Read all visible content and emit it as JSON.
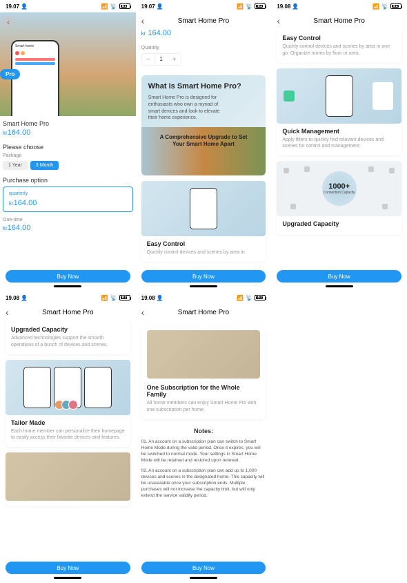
{
  "status": {
    "time1": "19.07",
    "time2": "19.08",
    "battery": "81",
    "user_icon": "👤"
  },
  "header": {
    "title": "Smart Home Pro"
  },
  "product": {
    "name": "Smart Home Pro",
    "currency": "kr",
    "price": "164.00",
    "pro_badge": "Pro"
  },
  "p1": {
    "choose": "Please choose",
    "package": "Package",
    "pills": [
      "1 Year",
      "3 Month"
    ],
    "pill_active": 1,
    "purchase_option": "Purchase option",
    "opt_quarterly": "quarterly",
    "opt_onetime": "One-time",
    "buy": "Buy Now"
  },
  "p2": {
    "quantity": "Quantity",
    "qty_val": "1",
    "promo_title": "What is Smart Home Pro?",
    "promo_desc": "Smart Home Pro is designed for enthusiasts who own a myriad of smart devices and look to elevate their home experience.",
    "banner1": "A Comprehensive Upgrade to Set",
    "banner2": "Your Smart Home Apart",
    "card1_title": "Easy Control",
    "card1_desc": "Quickly control devices and scenes by area in"
  },
  "p3": {
    "card1_title": "Easy Control",
    "card1_desc": "Quickly control devices and scenes by area in one go. Organize rooms by floor or area.",
    "card2_title": "Quick Management",
    "card2_desc": "Apply filters to quickly find relevant devices and scenes for control and management.",
    "card3_title": "Upgraded Capacity",
    "capacity_num": "1000+",
    "capacity_sub": "Connection Capacity"
  },
  "p4": {
    "card1_title": "Upgraded Capacity",
    "card1_desc": "Advanced technologies support the smooth operations of a bunch of devices and scenes.",
    "card2_title": "Tailor Made",
    "card2_desc": "Each home member can personalize their homepage to easily access their favorite devices and features."
  },
  "p5": {
    "card_title": "One Subscription for the Whole Family",
    "card_desc": "All home members can enjoy Smart Home Pro with one subscription per home.",
    "notes_title": "Notes:",
    "note1": "01. An account on a subscription plan can switch to Smart Home Mode during the valid period. Once it expires, you will be switched to normal mode. Your settings in Smart Home Mode will be retained and restored upon renewal.",
    "note2": "02. An account on a subscription plan can add up to 1,000 devices and scenes in the designated home. This capacity will be unavailable once your subscription ends. Multiple purchases will not increase the capacity limit, but will only extend the service validity period."
  }
}
